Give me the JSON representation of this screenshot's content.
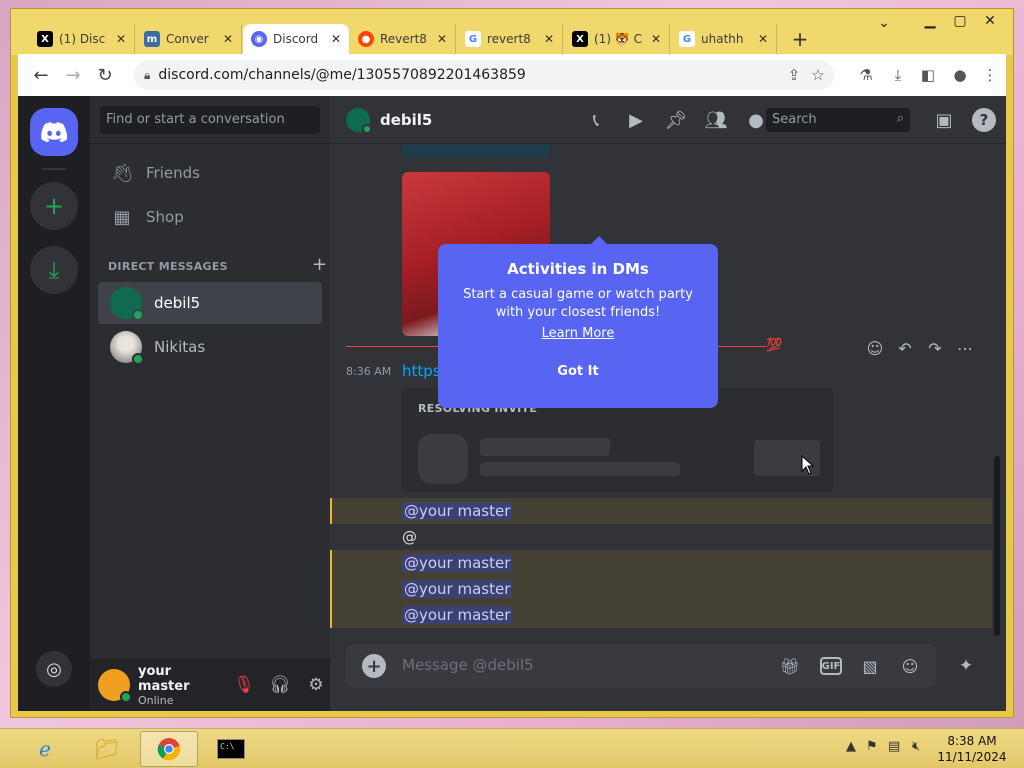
{
  "browser": {
    "tabs": [
      {
        "title": "(1) Disc",
        "favicon": "X",
        "color": "#000000"
      },
      {
        "title": "Conver",
        "favicon": "m",
        "color": "#3b6ea5"
      },
      {
        "title": "Discord",
        "favicon": "D",
        "color": "#5865f2"
      },
      {
        "title": "Revert8",
        "favicon": "R",
        "color": "#ff4500"
      },
      {
        "title": "revert8",
        "favicon": "G",
        "color": "#4285f4"
      },
      {
        "title": "(1) 🐯 C",
        "favicon": "X",
        "color": "#000000"
      },
      {
        "title": "uhathh",
        "favicon": "G",
        "color": "#4285f4"
      }
    ],
    "url": "discord.com/channels/@me/1305570892201463859"
  },
  "sidebar": {
    "search_placeholder": "Find or start a conversation",
    "friends_label": "Friends",
    "shop_label": "Shop",
    "dm_header": "DIRECT MESSAGES",
    "dms": [
      {
        "name": "debil5"
      },
      {
        "name": "Nikitas"
      }
    ]
  },
  "user_panel": {
    "name": "your master",
    "status": "Online"
  },
  "chat": {
    "channel_name": "debil5",
    "search_placeholder": "Search",
    "timestamp": "8:36 AM",
    "invite_link": "https://discord.gg/ERk89yt2",
    "invite_label": "RESOLVING INVITE",
    "reaction": "💯",
    "messages": [
      {
        "text": "@your master",
        "mention": true
      },
      {
        "text": "@",
        "mention": false
      },
      {
        "text": "@your master",
        "mention": true
      },
      {
        "text": "@your master",
        "mention": true
      },
      {
        "text": "@your master",
        "mention": true
      }
    ],
    "composer_placeholder": "Message @debil5"
  },
  "popout": {
    "title": "Activities in DMs",
    "body": "Start a casual game or watch party with your closest friends!",
    "link": "Learn More",
    "button": "Got It"
  },
  "taskbar": {
    "time": "8:38 AM",
    "date": "11/11/2024"
  },
  "colors": {
    "discord_blurple": "#5865f2",
    "online_green": "#23a559",
    "mention_highlight": "#444034",
    "mention_bar": "#f0b232",
    "link": "#00a8fc"
  }
}
